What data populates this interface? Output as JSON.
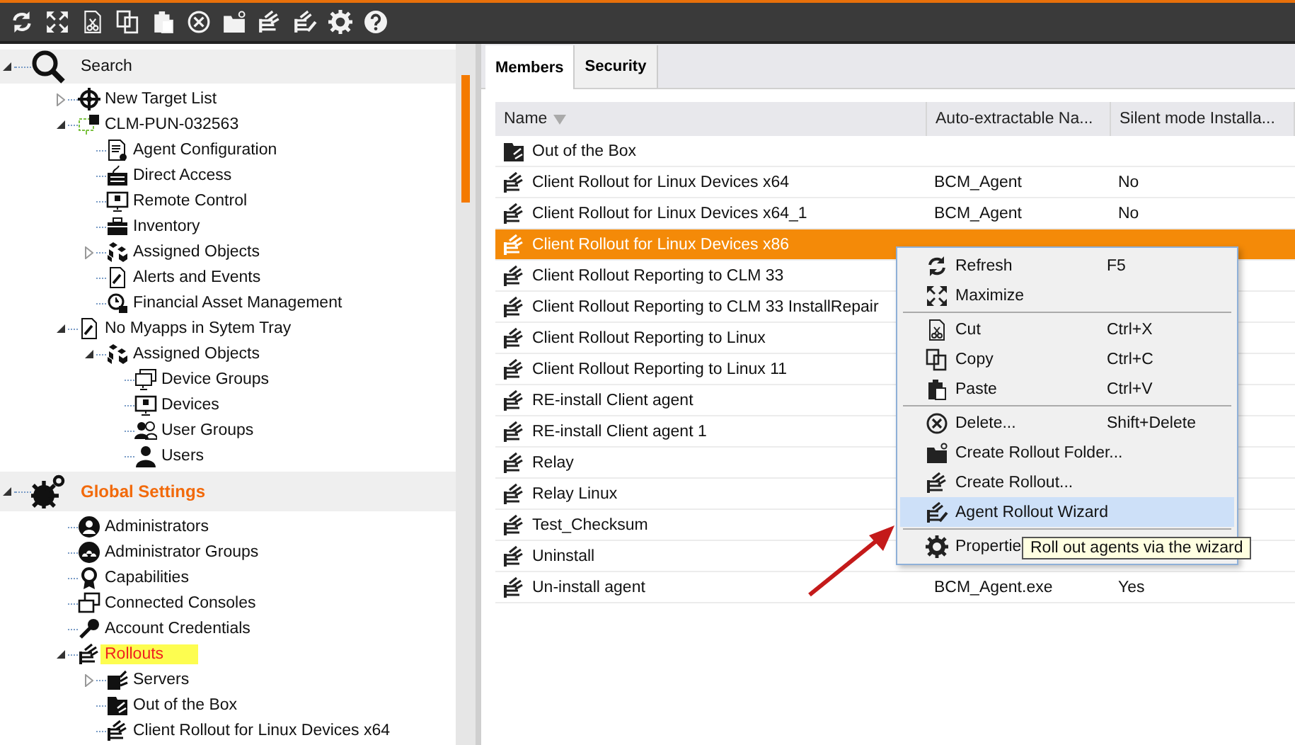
{
  "toolbar": {
    "buttons": [
      {
        "kind": "refresh"
      },
      {
        "kind": "maximize"
      },
      {
        "kind": "cut"
      },
      {
        "kind": "copy"
      },
      {
        "kind": "paste"
      },
      {
        "kind": "delete"
      },
      {
        "kind": "folder"
      },
      {
        "kind": "rollout"
      },
      {
        "kind": "wizard"
      },
      {
        "kind": "settings"
      },
      {
        "kind": "help"
      }
    ]
  },
  "tree": [
    {
      "label": "Search",
      "kind": "header",
      "expanded": true,
      "highlighted": false,
      "children": [
        {
          "label": "New Target List",
          "kind": "item",
          "expanded": false,
          "highlighted": false
        },
        {
          "label": "CLM-PUN-032563",
          "kind": "item",
          "expanded": true,
          "highlighted": false,
          "children": [
            {
              "label": "Agent Configuration",
              "kind": "item",
              "highlighted": false
            },
            {
              "label": "Direct Access",
              "kind": "item",
              "highlighted": false
            },
            {
              "label": "Remote Control",
              "kind": "item",
              "highlighted": false
            },
            {
              "label": "Inventory",
              "kind": "item",
              "highlighted": false
            },
            {
              "label": "Assigned Objects",
              "kind": "item",
              "expanded": false,
              "highlighted": false
            },
            {
              "label": "Alerts and Events",
              "kind": "item",
              "highlighted": false
            },
            {
              "label": "Financial Asset Management",
              "kind": "item",
              "highlighted": false
            }
          ]
        },
        {
          "label": "No Myapps in Sytem Tray",
          "kind": "item",
          "expanded": true,
          "highlighted": false,
          "children": [
            {
              "label": "Assigned Objects",
              "kind": "item",
              "expanded": true,
              "highlighted": false,
              "children": [
                {
                  "label": "Device Groups",
                  "kind": "item",
                  "highlighted": false
                },
                {
                  "label": "Devices",
                  "kind": "item",
                  "highlighted": false
                },
                {
                  "label": "User Groups",
                  "kind": "item",
                  "highlighted": false
                },
                {
                  "label": "Users",
                  "kind": "item",
                  "highlighted": false
                }
              ]
            }
          ]
        }
      ]
    },
    {
      "label": "Global Settings",
      "kind": "header",
      "expanded": true,
      "highlighted": false,
      "children": [
        {
          "label": "Administrators",
          "kind": "item",
          "highlighted": false
        },
        {
          "label": "Administrator Groups",
          "kind": "item",
          "highlighted": false
        },
        {
          "label": "Capabilities",
          "kind": "item",
          "highlighted": false
        },
        {
          "label": "Connected Consoles",
          "kind": "item",
          "highlighted": false
        },
        {
          "label": "Account Credentials",
          "kind": "item",
          "highlighted": false
        },
        {
          "label": "Rollouts",
          "kind": "item",
          "expanded": true,
          "highlighted": true,
          "children": [
            {
              "label": "Servers",
              "kind": "item",
              "expanded": false,
              "highlighted": false
            },
            {
              "label": "Out of the Box",
              "kind": "item",
              "highlighted": false
            },
            {
              "label": "Client Rollout for Linux Devices x64",
              "kind": "item",
              "highlighted": false
            }
          ]
        }
      ]
    }
  ],
  "tabs": [
    {
      "label": "Members",
      "selected": true
    },
    {
      "label": "Security",
      "selected": false
    }
  ],
  "table": {
    "columns": [
      "Name",
      "Auto-extractable Na...",
      "Silent mode Installa..."
    ],
    "rows": [
      {
        "kind": "folder",
        "selected": false,
        "cells": [
          "Out of the Box"
        ]
      },
      {
        "kind": "rollout",
        "selected": false,
        "cells": [
          "Client Rollout for Linux Devices x64",
          "BCM_Agent",
          "No"
        ]
      },
      {
        "kind": "rollout",
        "selected": false,
        "cells": [
          "Client Rollout for Linux Devices x64_1",
          "BCM_Agent",
          "No"
        ]
      },
      {
        "kind": "rollout",
        "selected": true,
        "cells": [
          "Client Rollout for Linux Devices x86"
        ]
      },
      {
        "kind": "rollout",
        "selected": false,
        "cells": [
          "Client Rollout Reporting to CLM 33"
        ]
      },
      {
        "kind": "rollout",
        "selected": false,
        "cells": [
          "Client Rollout Reporting to CLM 33 InstallRepair"
        ]
      },
      {
        "kind": "rollout",
        "selected": false,
        "cells": [
          "Client Rollout Reporting to Linux"
        ]
      },
      {
        "kind": "rollout",
        "selected": false,
        "cells": [
          "Client Rollout Reporting to Linux 11"
        ]
      },
      {
        "kind": "rollout",
        "selected": false,
        "cells": [
          "RE-install Client agent"
        ]
      },
      {
        "kind": "rollout",
        "selected": false,
        "cells": [
          "RE-install Client agent 1"
        ]
      },
      {
        "kind": "rollout",
        "selected": false,
        "cells": [
          "Relay"
        ]
      },
      {
        "kind": "rollout",
        "selected": false,
        "cells": [
          "Relay Linux"
        ]
      },
      {
        "kind": "rollout",
        "selected": false,
        "cells": [
          "Test_Checksum"
        ]
      },
      {
        "kind": "rollout",
        "selected": false,
        "cells": [
          "Uninstall"
        ]
      },
      {
        "kind": "rollout",
        "selected": false,
        "cells": [
          "Un-install agent",
          "BCM_Agent.exe",
          "Yes"
        ]
      }
    ]
  },
  "context_menu": [
    {
      "kind": "refresh",
      "label": "Refresh",
      "shortcut": "F5",
      "highlighted": false
    },
    {
      "kind": "maximize",
      "label": "Maximize",
      "highlighted": false
    },
    {
      "kind": "separator"
    },
    {
      "kind": "cut",
      "label": "Cut",
      "shortcut": "Ctrl+X",
      "highlighted": false
    },
    {
      "kind": "copy",
      "label": "Copy",
      "shortcut": "Ctrl+C",
      "highlighted": false
    },
    {
      "kind": "paste",
      "label": "Paste",
      "shortcut": "Ctrl+V",
      "highlighted": false
    },
    {
      "kind": "separator"
    },
    {
      "kind": "delete",
      "label": "Delete...",
      "shortcut": "Shift+Delete",
      "highlighted": false
    },
    {
      "kind": "folder",
      "label": "Create Rollout Folder...",
      "highlighted": false
    },
    {
      "kind": "rollout",
      "label": "Create Rollout...",
      "highlighted": false
    },
    {
      "kind": "wizard",
      "label": "Agent Rollout Wizard",
      "highlighted": true
    },
    {
      "kind": "separator"
    },
    {
      "kind": "settings",
      "label": "Propertie",
      "highlighted": false
    }
  ],
  "tooltip": "Roll out agents via the wizard"
}
